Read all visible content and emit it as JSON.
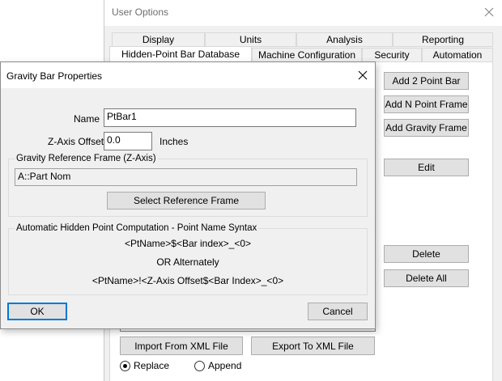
{
  "background_window": {
    "title": "User Options",
    "tabs_row1": [
      "Display",
      "Units",
      "Analysis",
      "Reporting"
    ],
    "tabs_row2": [
      "Hidden-Point Bar Database",
      "Machine Configuration",
      "Security",
      "Automation"
    ],
    "active_tab": "Hidden-Point Bar Database",
    "buttons": {
      "add_2_point_bar": "Add 2 Point Bar",
      "add_n_point_frame": "Add N Point Frame",
      "add_gravity_frame": "Add Gravity Frame",
      "edit": "Edit",
      "delete": "Delete",
      "delete_all": "Delete All",
      "import_xml": "Import From XML File",
      "export_xml": "Export To XML File"
    },
    "radio_replace": {
      "label": "Replace",
      "checked": true
    },
    "radio_append": {
      "label": "Append",
      "checked": false
    }
  },
  "dialog": {
    "title": "Gravity Bar Properties",
    "name_label": "Name",
    "name_value": "PtBar1",
    "zoffset_label": "Z-Axis Offset",
    "zoffset_value": "0.0",
    "zoffset_unit": "Inches",
    "gravity_group_label": "Gravity Reference Frame (Z-Axis)",
    "gravity_frame_value": "A::Part Nom",
    "select_ref_frame_button": "Select Reference Frame",
    "auto_group_label": "Automatic Hidden Point Computation - Point Name Syntax",
    "syntax_line1": "<PtName>$<Bar index>_<0>",
    "syntax_or": "OR Alternately",
    "syntax_line2": "<PtName>!<Z-Axis Offset$<Bar Index>_<0>",
    "ok_button": "OK",
    "cancel_button": "Cancel"
  },
  "colors": {
    "dialog_bg": "#f0f0f0",
    "button_bg": "#e1e1e1",
    "focus_border": "#0078d7"
  }
}
